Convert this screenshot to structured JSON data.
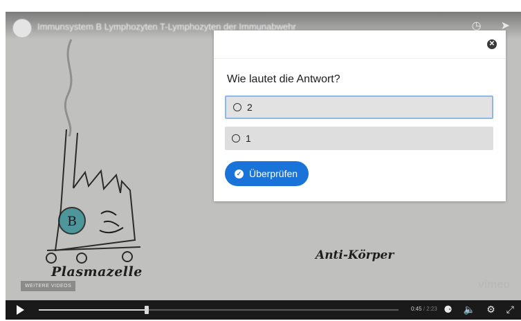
{
  "video": {
    "title": "Immunsystem B Lymphozyten T-Lymphozyten der Immunabwehr",
    "labels": {
      "plasma": "Plasmazelle",
      "antibody": "Anti-Körper"
    },
    "more_videos": "WEITERE VIDEOS",
    "brand": "vimeo"
  },
  "controls": {
    "elapsed": "0:45",
    "duration": "/ 2:23",
    "progress": 0.3
  },
  "quiz": {
    "question": "Wie lautet die Antwort?",
    "options": [
      {
        "label": "2",
        "selected": true
      },
      {
        "label": "1",
        "selected": false
      }
    ],
    "check_label": "Überprüfen",
    "close_symbol": "✕"
  },
  "icons": {
    "close": "close-icon",
    "check": "check-circle-icon",
    "play": "play-icon",
    "settings": "gear-icon",
    "volume": "volume-icon",
    "fullscreen": "fullscreen-icon"
  },
  "colors": {
    "accent": "#1a73d9",
    "option_bg": "#dedede",
    "selected_border": "#8bb8e8",
    "controls_bg": "#1a1a1a"
  }
}
